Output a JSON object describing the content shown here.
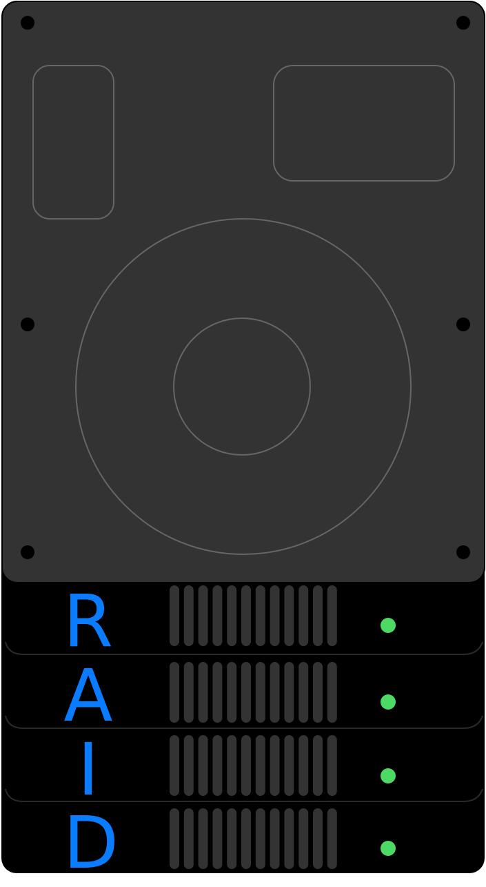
{
  "raid_unit": {
    "colors": {
      "chassis": "#333333",
      "chassis_stroke": "#000000",
      "detail_lines": "#666666",
      "screws": "#000000",
      "bay_face": "#000000",
      "bay_separator": "#2a2a2a",
      "vent": "#333333",
      "led": "#4cd964",
      "letters": "#0a7cff"
    },
    "top_cover": {
      "screw_icon": "screw-icon",
      "platter_icon": "disk-platter-icon"
    },
    "bays": [
      {
        "letter": "R",
        "status": "active"
      },
      {
        "letter": "A",
        "status": "active"
      },
      {
        "letter": "I",
        "status": "active"
      },
      {
        "letter": "D",
        "status": "active"
      }
    ]
  }
}
